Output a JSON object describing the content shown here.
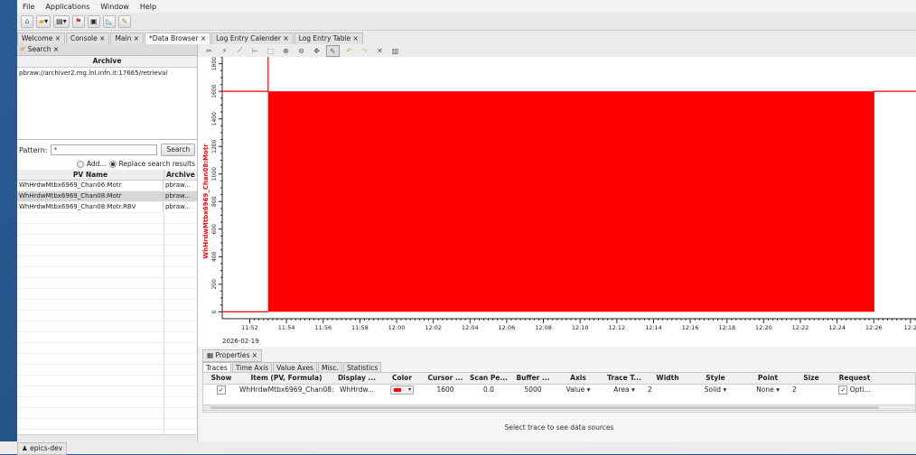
{
  "menu": [
    "File",
    "Applications",
    "Window",
    "Help"
  ],
  "main_tabs": [
    "Welcome ×",
    "Console ×",
    "Main ×",
    "*Data Browser ×",
    "Log Entry Calender ×",
    "Log Entry Table ×"
  ],
  "search_panel": {
    "tab": "Search ×",
    "archive_header": "Archive",
    "archive_url": "pbraw://archiver2.mg.lnl.infn.it:17665/retrieval",
    "pattern_label": "Pattern:",
    "pattern_value": "*",
    "search_button": "Search",
    "add_label": "Add...",
    "replace_label": "Replace search results",
    "columns": [
      "PV Name",
      "Archive"
    ],
    "rows": [
      {
        "name": "WhHrdwMtbx6969_Chan06:Motr",
        "archive": "pbraw..."
      },
      {
        "name": "WhHrdwMtbx6969_Chan08:Motr",
        "archive": "pbraw..."
      },
      {
        "name": "WhHrdwMtbx6969_Chan08:Motr.RBV",
        "archive": "pbraw..."
      }
    ]
  },
  "chart_data": {
    "type": "area",
    "ylabel": "WhHrdwMtbx6969_Chan08:Motr",
    "y_ticks": [
      "0",
      "200",
      "400",
      "600",
      "800",
      "1000",
      "1200",
      "1400",
      "1600",
      "1800"
    ],
    "ylim": [
      -50,
      1850
    ],
    "x_ticks": [
      "11:52",
      "11:54",
      "11:56",
      "11:58",
      "12:00",
      "12:02",
      "12:04",
      "12:06",
      "12:08",
      "12:10",
      "12:12",
      "12:14",
      "12:16",
      "12:18",
      "12:20",
      "12:22",
      "12:24",
      "12:26",
      "12:2"
    ],
    "x_date": "2026-02-19",
    "series": [
      {
        "name": "WhHrdwMtbx6969_Chan08:Motr",
        "color": "#ff0000",
        "points": [
          [
            "11:52",
            1600
          ],
          [
            "11:53",
            1600
          ],
          [
            "11:53",
            0
          ],
          [
            "12:26",
            0
          ],
          [
            "12:26",
            1600
          ],
          [
            "12:27",
            1600
          ]
        ]
      }
    ]
  },
  "properties": {
    "tab": "Properties ×",
    "subtabs": [
      "Traces",
      "Time Axis",
      "Value Axes",
      "Misc.",
      "Statistics"
    ],
    "columns": [
      "Show",
      "Item (PV, Formula)",
      "Display ...",
      "Color",
      "Cursor ...",
      "Scan Pe...",
      "Buffer ...",
      "Axis",
      "Trace T...",
      "Width",
      "Style",
      "Point",
      "Size",
      "Request"
    ],
    "row": {
      "show": "✓",
      "item": "WhHrdwMtbx6969_Chan08:Motr",
      "display": "WhHrdw...",
      "color": "#ff0000",
      "cursor": "1600",
      "scan": "0.0",
      "buffer": "5000",
      "axis": "Value",
      "trace": "Area",
      "width": "2",
      "style": "Solid",
      "point": "None",
      "size": "2",
      "request": "Opti..."
    },
    "sources_hint": "Select trace to see data sources"
  },
  "taskbar_item": "epics-dev"
}
